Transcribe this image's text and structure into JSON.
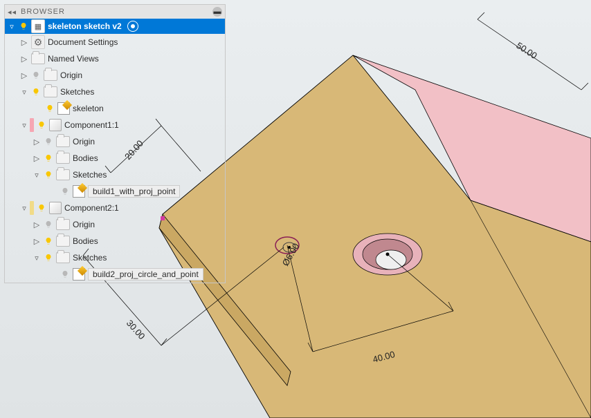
{
  "panel": {
    "title": "BROWSER",
    "arrows_glyph": "◂◂",
    "minimize_glyph": "▬"
  },
  "root": {
    "name": "skeleton sketch v2"
  },
  "items": {
    "doc_settings": "Document Settings",
    "named_views": "Named Views",
    "origin": "Origin",
    "sketches": "Sketches",
    "skeleton": "skeleton",
    "component1": "Component1:1",
    "component2": "Component2:1",
    "bodies": "Bodies",
    "build1": "build1_with_proj_point",
    "build2": "build2_proj_circle_and_point"
  },
  "dims": {
    "d50": "50.00",
    "d20": "20.00",
    "d40": "40.00",
    "d30": "30.00",
    "dia6": "Ø6.00"
  }
}
